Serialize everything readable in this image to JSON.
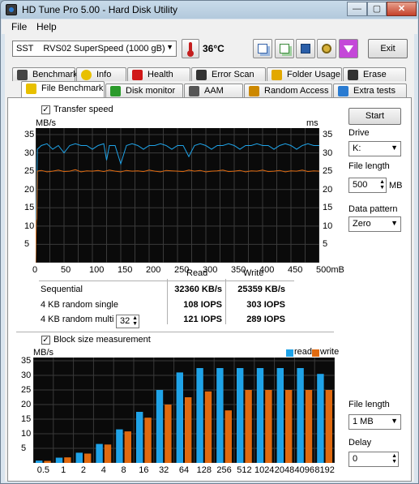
{
  "window": {
    "title": "HD Tune Pro 5.00 - Hard Disk Utility",
    "buttons": [
      "—",
      "▢",
      "✕"
    ]
  },
  "menu": {
    "file": "File",
    "help": "Help"
  },
  "toolbar": {
    "drive": "SST    RVS02 SuperSpeed (1000 gB)",
    "temperature": "36°C",
    "exit": "Exit"
  },
  "tabs_top": [
    "Benchmark",
    "Info",
    "Health",
    "Error Scan",
    "Folder Usage",
    "Erase"
  ],
  "tabs_bottom": [
    "File Benchmark",
    "Disk monitor",
    "AAM",
    "Random Access",
    "Extra tests"
  ],
  "transfer": {
    "checkbox_label": "Transfer speed",
    "y_left_unit": "MB/s",
    "y_right_unit": "ms",
    "y_ticks": [
      "35",
      "30",
      "25",
      "20",
      "15",
      "10",
      "5"
    ],
    "x_ticks": [
      "0",
      "50",
      "100",
      "150",
      "200",
      "250",
      "300",
      "350",
      "400",
      "450",
      "500mB"
    ]
  },
  "results": {
    "read_header": "Read",
    "write_header": "Write",
    "rows": [
      {
        "label": "Sequential",
        "read": "32360 KB/s",
        "write": "25359 KB/s"
      },
      {
        "label": "4 KB random single",
        "read": "108 IOPS",
        "write": "303 IOPS"
      },
      {
        "label": "4 KB random multi",
        "read": "121 IOPS",
        "write": "289 IOPS"
      }
    ],
    "queue_depth": "32"
  },
  "block": {
    "checkbox_label": "Block size measurement",
    "unit": "MB/s",
    "legend_read": "read",
    "legend_write": "write",
    "y_ticks": [
      "35",
      "30",
      "25",
      "20",
      "15",
      "10",
      "5"
    ]
  },
  "side": {
    "start": "Start",
    "drive_label": "Drive",
    "drive_value": "K:",
    "file_length_label": "File length",
    "file_length_value": "500",
    "file_length_unit": "MB",
    "data_pattern_label": "Data pattern",
    "data_pattern_value": "Zero",
    "block_file_length_label": "File length",
    "block_file_length_value": "1 MB",
    "delay_label": "Delay",
    "delay_value": "0"
  },
  "colors": {
    "read": "#1fa3e8",
    "write": "#e06a10",
    "grid": "#3a3a3a"
  },
  "chart_data": [
    {
      "type": "line",
      "title": "",
      "xlabel": "",
      "ylabel": "MB/s",
      "xlim": [
        0,
        500
      ],
      "ylim": [
        0,
        35
      ],
      "series": [
        {
          "name": "Read",
          "x": [
            0,
            1,
            3,
            10,
            20,
            30,
            40,
            50,
            60,
            70,
            80,
            90,
            100,
            110,
            120,
            125,
            130,
            140,
            150,
            160,
            170,
            180,
            190,
            200,
            210,
            220,
            230,
            240,
            250,
            260,
            270,
            280,
            290,
            300,
            310,
            320,
            330,
            340,
            350,
            360,
            370,
            380,
            390,
            400,
            410,
            420,
            430,
            440,
            450,
            460,
            470,
            480,
            490,
            500
          ],
          "values": [
            0,
            10,
            31,
            32,
            32.5,
            31,
            32,
            30,
            32,
            32.5,
            32,
            32,
            31,
            32,
            32.5,
            28,
            32,
            32,
            27,
            32,
            32.5,
            32,
            31,
            32,
            32,
            32.5,
            32,
            31,
            32,
            32,
            29,
            32,
            32.5,
            32,
            31,
            32,
            32,
            32.5,
            32,
            31,
            32,
            32,
            32.5,
            32,
            32,
            31,
            32,
            32.5,
            32,
            31,
            32,
            32.5,
            32,
            32
          ]
        },
        {
          "name": "Write",
          "x": [
            0,
            1,
            2,
            3,
            10,
            20,
            30,
            40,
            50,
            60,
            70,
            80,
            90,
            100,
            110,
            120,
            130,
            140,
            150,
            160,
            170,
            180,
            190,
            200,
            210,
            220,
            230,
            240,
            250,
            260,
            270,
            280,
            290,
            300,
            310,
            320,
            330,
            340,
            350,
            360,
            370,
            380,
            390,
            400,
            410,
            420,
            430,
            440,
            450,
            460,
            470,
            480,
            490,
            500
          ],
          "values": [
            0,
            11,
            12,
            25,
            25.2,
            24.8,
            25,
            25.3,
            24.9,
            25,
            25.4,
            24.8,
            25.1,
            25,
            25.2,
            24.9,
            25.3,
            25,
            24.8,
            25.2,
            25,
            25.1,
            24.9,
            25.3,
            25,
            24.8,
            25.2,
            25.1,
            25,
            24.9,
            25.3,
            25,
            25.2,
            24.8,
            25,
            25.1,
            25.3,
            24.9,
            25,
            25.2,
            24.8,
            25.1,
            25,
            25.3,
            24.9,
            25,
            25.2,
            24.8,
            25.1,
            25,
            25.3,
            24.9,
            25.1,
            25
          ]
        }
      ]
    },
    {
      "type": "bar",
      "title": "",
      "xlabel": "",
      "ylabel": "MB/s",
      "ylim": [
        0,
        35
      ],
      "categories": [
        "0.5",
        "1",
        "2",
        "4",
        "8",
        "16",
        "32",
        "64",
        "128",
        "256",
        "512",
        "1024",
        "2048",
        "4096",
        "8192"
      ],
      "series": [
        {
          "name": "read",
          "values": [
            0.8,
            1.8,
            3.5,
            6.5,
            11.5,
            17.5,
            25,
            31,
            32.5,
            32.5,
            32.5,
            32.5,
            32.5,
            32.5,
            30.5
          ]
        },
        {
          "name": "write",
          "values": [
            0.7,
            1.9,
            3.2,
            6.3,
            10.8,
            15.5,
            20,
            22.5,
            24.5,
            18,
            25,
            25,
            25,
            25,
            25
          ]
        }
      ]
    }
  ]
}
